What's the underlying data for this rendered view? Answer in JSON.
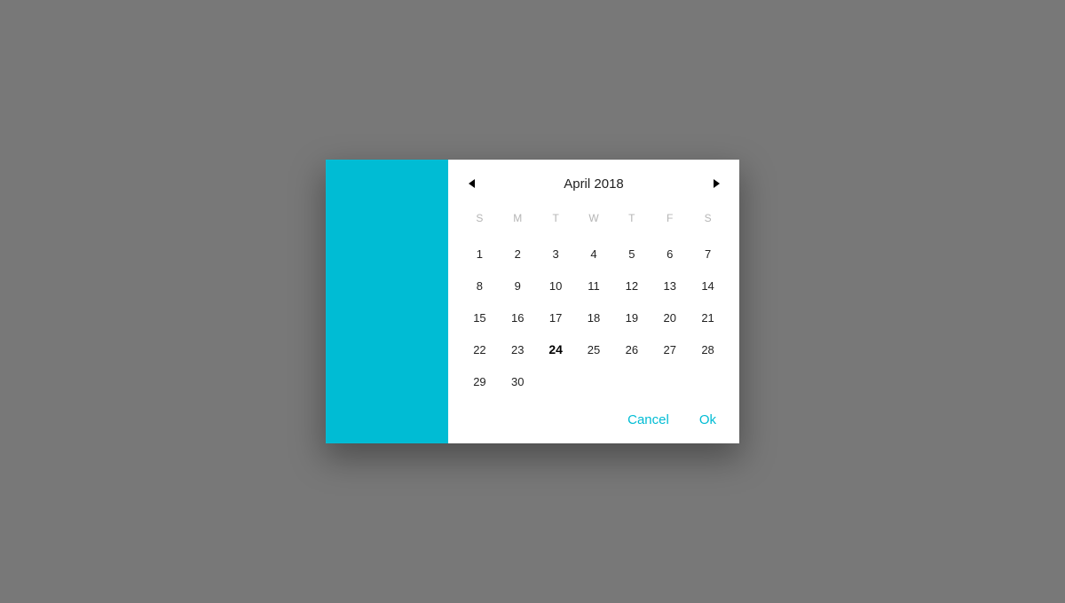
{
  "colors": {
    "accent": "#00bcd4",
    "background": "#787878"
  },
  "calendar": {
    "title": "April 2018",
    "dow": [
      "S",
      "M",
      "T",
      "W",
      "T",
      "F",
      "S"
    ],
    "startOffset": 0,
    "daysInMonth": 30,
    "today": 24
  },
  "actions": {
    "cancel": "Cancel",
    "ok": "Ok"
  }
}
